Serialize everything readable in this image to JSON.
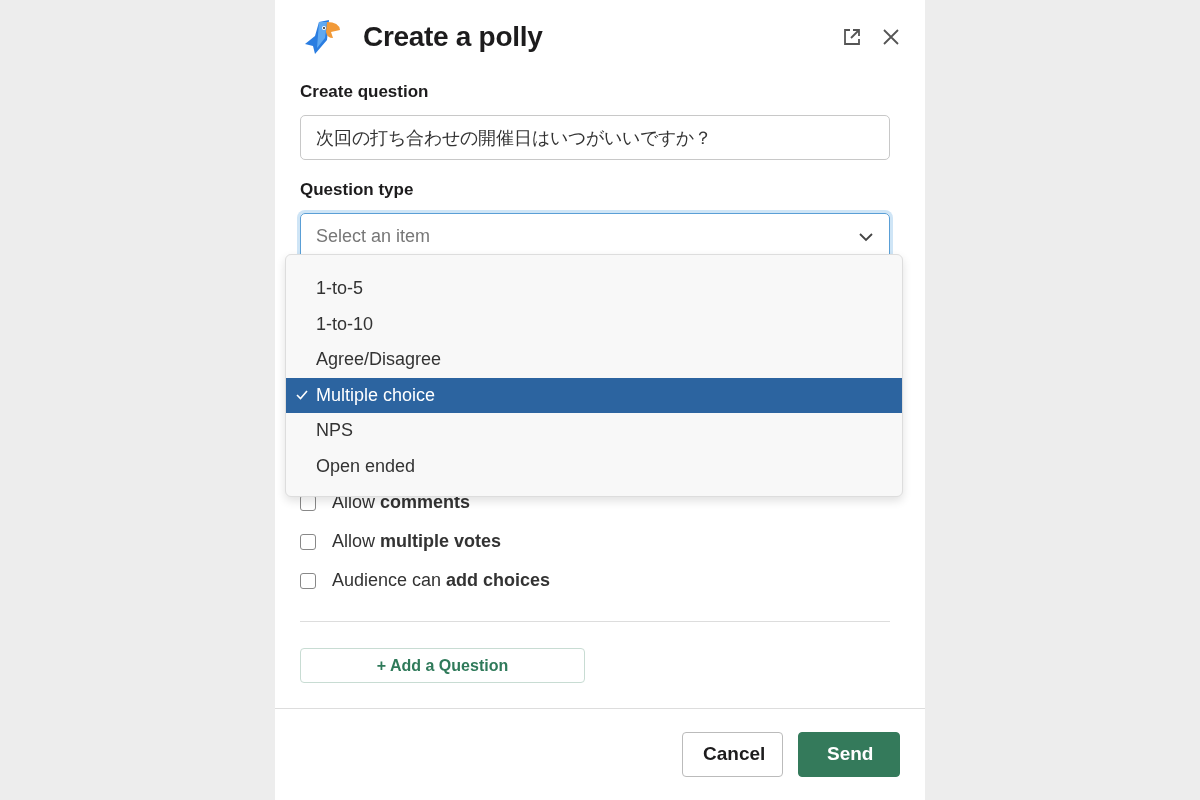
{
  "modal": {
    "title": "Create a polly"
  },
  "question": {
    "label": "Create question",
    "value": "次回の打ち合わせの開催日はいつがいいですか？"
  },
  "question_type": {
    "label": "Question type",
    "placeholder": "Select an item",
    "focused": true,
    "open": true,
    "options": [
      {
        "label": "1-to-5",
        "selected": false
      },
      {
        "label": "1-to-10",
        "selected": false
      },
      {
        "label": "Agree/Disagree",
        "selected": false
      },
      {
        "label": "Multiple choice",
        "selected": true
      },
      {
        "label": "NPS",
        "selected": false
      },
      {
        "label": "Open ended",
        "selected": false
      }
    ]
  },
  "settings": [
    {
      "label": "Allow **comments**",
      "checked": false
    },
    {
      "label": "Allow **multiple votes**",
      "checked": false
    },
    {
      "label": "Audience can **add choices**",
      "checked": false
    }
  ],
  "add_question": "+ Add a Question",
  "buttons": {
    "cancel": "Cancel",
    "send": "Send"
  }
}
